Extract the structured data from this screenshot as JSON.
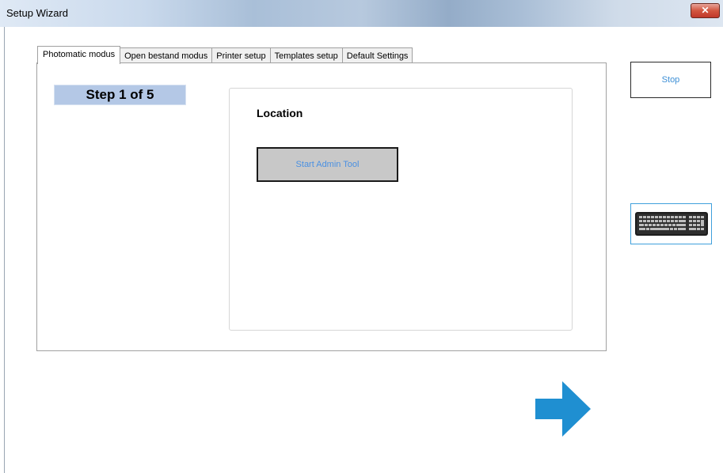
{
  "window": {
    "title": "Setup Wizard",
    "close_glyph": "✕"
  },
  "tabs": [
    {
      "label": "Photomatic modus",
      "active": true
    },
    {
      "label": "Open bestand modus",
      "active": false
    },
    {
      "label": "Printer setup",
      "active": false
    },
    {
      "label": "Templates setup",
      "active": false
    },
    {
      "label": "Default Settings",
      "active": false
    }
  ],
  "step": {
    "label": "Step 1 of 5"
  },
  "location": {
    "title": "Location",
    "admin_button_label": "Start Admin Tool"
  },
  "side": {
    "stop_label": "Stop",
    "keyboard_icon": "keyboard-icon"
  },
  "navigation": {
    "next_icon": "arrow-right-icon"
  },
  "colors": {
    "accent_blue": "#1f8fd1",
    "step_bg": "#b4c8e6",
    "admin_btn_bg": "#c8c8c8",
    "admin_btn_text": "#4a90e2",
    "stop_text": "#3d8fd6",
    "close_red": "#c0382a"
  }
}
